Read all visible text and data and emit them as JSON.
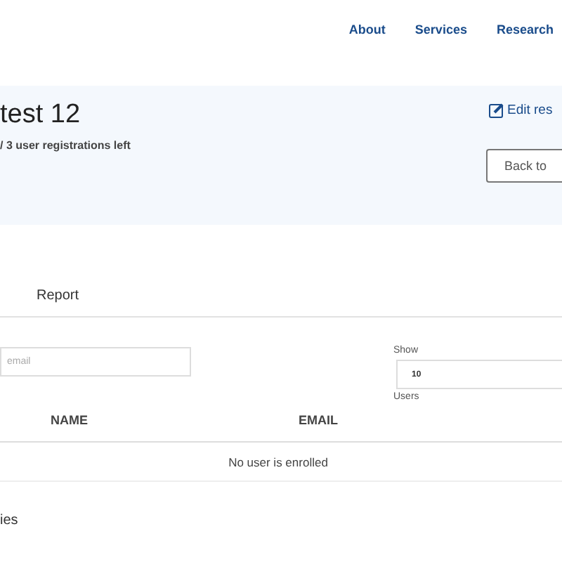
{
  "nav": [
    "About",
    "Services",
    "Research"
  ],
  "header": {
    "title": "test 12",
    "registrations": "/ 3 user registrations left",
    "edit_link": "Edit res",
    "back_button": "Back to"
  },
  "tabs": [
    {
      "label": "Report",
      "selected": false
    }
  ],
  "search": {
    "placeholder": "email"
  },
  "page_size": {
    "label": "Show",
    "value": "10",
    "suffix": "Users"
  },
  "table": {
    "columns": [
      "NAME",
      "EMAIL"
    ],
    "empty_message": "No user is enrolled"
  },
  "footer_heading": "ies"
}
